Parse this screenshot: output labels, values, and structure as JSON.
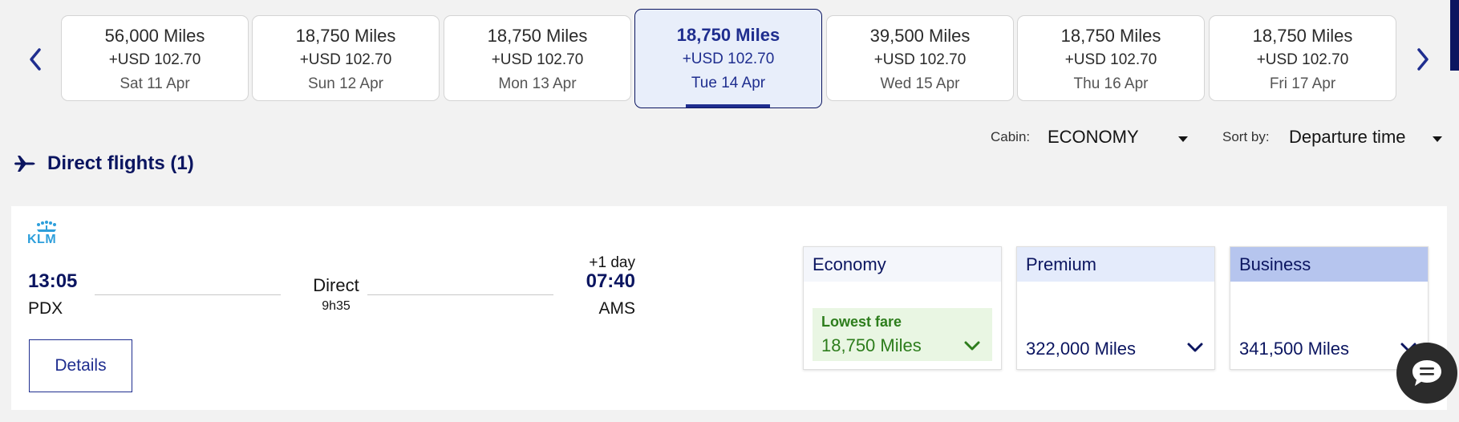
{
  "carousel": {
    "dates": [
      {
        "miles": "56,000 Miles",
        "usd": "+USD 102.70",
        "date": "Sat 11 Apr"
      },
      {
        "miles": "18,750 Miles",
        "usd": "+USD 102.70",
        "date": "Sun 12 Apr"
      },
      {
        "miles": "18,750 Miles",
        "usd": "+USD 102.70",
        "date": "Mon 13 Apr"
      },
      {
        "miles": "18,750 Miles",
        "usd": "+USD 102.70",
        "date": "Tue 14 Apr"
      },
      {
        "miles": "39,500 Miles",
        "usd": "+USD 102.70",
        "date": "Wed 15 Apr"
      },
      {
        "miles": "18,750 Miles",
        "usd": "+USD 102.70",
        "date": "Thu 16 Apr"
      },
      {
        "miles": "18,750 Miles",
        "usd": "+USD 102.70",
        "date": "Fri 17 Apr"
      }
    ],
    "selected_date": "Tue 14 Apr"
  },
  "filters": {
    "cabin_label": "Cabin:",
    "cabin_value": "ECONOMY",
    "sort_label": "Sort by:",
    "sort_value": "Departure time"
  },
  "section": {
    "title": "Direct flights (1)"
  },
  "flight": {
    "airline_logo_text": "KLM",
    "departure_time": "13:05",
    "departure_airport": "PDX",
    "stops": "Direct",
    "duration": "9h35",
    "day_offset": "+1 day",
    "arrival_time": "07:40",
    "arrival_airport": "AMS",
    "details_label": "Details",
    "fares": {
      "economy": {
        "name": "Economy",
        "badge": "Lowest fare",
        "miles": "18,750 Miles"
      },
      "premium": {
        "name": "Premium",
        "miles": "322,000 Miles"
      },
      "business": {
        "name": "Business",
        "miles": "341,500 Miles"
      }
    }
  },
  "colors": {
    "brand_dark": "#0b1560",
    "brand": "#1f2e8f",
    "lowest_fare_green": "#2d7d1c",
    "klm_blue": "#2e9fdb"
  }
}
